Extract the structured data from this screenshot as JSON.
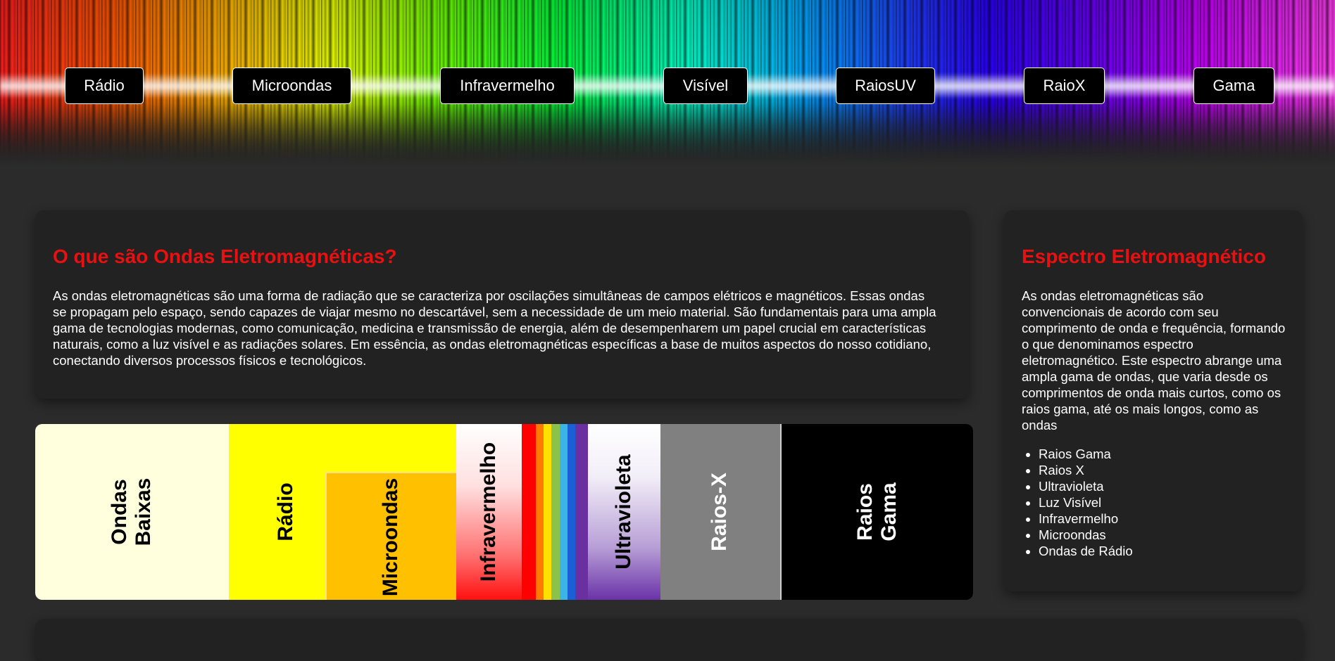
{
  "nav": {
    "items": [
      "Rádio",
      "Microondas",
      "Infravermelho",
      "Visível",
      "RaiosUV",
      "RaioX",
      "Gama"
    ]
  },
  "main_card": {
    "title": "O que são Ondas Eletromagnéticas?",
    "body": "As ondas eletromagnéticas são uma forma de radiação que se caracteriza por oscilações simultâneas de campos elétricos e magnéticos. Essas ondas se propagam pelo espaço, sendo capazes de viajar mesmo no descartável, sem a necessidade de um meio material. São fundamentais para uma ampla gama de tecnologias modernas, como comunicação, medicina e transmissão de energia, além de desempenharem um papel crucial em características naturais, como a luz visível e as radiações solares. Em essência, as ondas eletromagnéticas específicas a base de muitos aspectos do nosso cotidiano, conectando diversos processos físicos e tecnológicos."
  },
  "side_card": {
    "title": "Espectro Eletromagnético",
    "body": "As ondas eletromagnéticas são convencionais de acordo com seu comprimento de onda e frequência, formando o que denominamos espectro eletromagnético. Este espectro abrange uma ampla gama de ondas, que varia desde os comprimentos de onda mais curtos, como os raios gama, até os mais longos, como as ondas",
    "list": [
      "Raios Gama",
      "Raios X",
      "Ultravioleta",
      "Luz Visível",
      "Infravermelho",
      "Microondas",
      "Ondas de Rádio"
    ]
  },
  "spectrum_image": {
    "labels": {
      "ondas_baixas": "Ondas\nBaixas",
      "radio": "Rádio",
      "microondas": "Microondas",
      "infravermelho": "Infravermelho",
      "ultravioleta": "Ultravioleta",
      "raios_x": "Raios-X",
      "raios_gama": "Raios\nGama"
    },
    "colors": {
      "ondas_baixas": "#ffffdd",
      "radio": "#ffff00",
      "microondas": "#ffc000",
      "raios_x": "#808080",
      "raios_gama": "#000000",
      "accent_title": "#e81010"
    }
  }
}
